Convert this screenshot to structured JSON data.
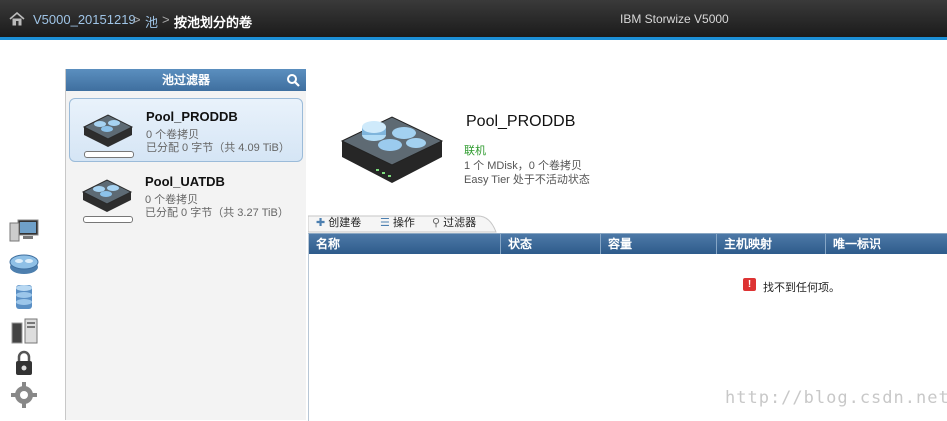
{
  "header": {
    "breadcrumb": [
      "V5000_20151219",
      "池",
      "按池划分的卷"
    ],
    "separator": ">",
    "app_title": "IBM Storwize V5000",
    "icon": "home-icon"
  },
  "left_rail": {
    "icons": [
      "monitoring-icon",
      "pools-icon",
      "volumes-icon",
      "hosts-icon",
      "access-icon",
      "settings-icon"
    ]
  },
  "pool_panel": {
    "title": "池过滤器",
    "search_icon": "search-icon",
    "pools": [
      {
        "name": "Pool_PRODDB",
        "copies": "0 个卷拷贝",
        "allocation": "已分配 0 字节（共 4.09 TiB）",
        "selected": true
      },
      {
        "name": "Pool_UATDB",
        "copies": "0 个卷拷贝",
        "allocation": "已分配 0 字节（共 3.27 TiB）",
        "selected": false
      }
    ]
  },
  "detail": {
    "name": "Pool_PRODDB",
    "status": "联机",
    "mdisk_line": "1 个 MDisk，0 个卷拷贝",
    "easy_tier": "Easy Tier 处于不活动状态"
  },
  "toolbar": {
    "create_volume": "创建卷",
    "actions": "操作",
    "filter": "过滤器"
  },
  "table": {
    "columns": [
      "名称",
      "状态",
      "容量",
      "主机映射",
      "唯一标识"
    ],
    "empty_message": "找不到任何项。"
  },
  "watermark": "http://blog.csdn.net/",
  "colors": {
    "accent": "#1c8fd6",
    "header_blue": "#3f6f9f",
    "status_green": "#2e9b2e"
  }
}
